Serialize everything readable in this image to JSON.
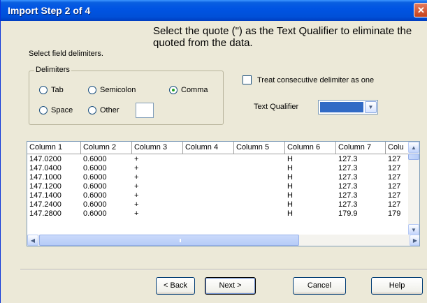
{
  "window": {
    "title": "Import Step 2 of 4",
    "close": "✕"
  },
  "instruction": "Select the quote (\") as the Text Qualifier to eliminate the quoted from the data.",
  "select_label": "Select field delimiters.",
  "delimiters": {
    "title": "Delimiters",
    "options": [
      {
        "label": "Tab",
        "checked": false
      },
      {
        "label": "Semicolon",
        "checked": false
      },
      {
        "label": "Comma",
        "checked": true
      },
      {
        "label": "Space",
        "checked": false
      },
      {
        "label": "Other",
        "checked": false
      }
    ],
    "other_value": ""
  },
  "consecutive": {
    "label": "Treat consecutive delimiter as one",
    "checked": false
  },
  "text_qualifier": {
    "label": "Text Qualifier",
    "value": "\"",
    "arrow": "▼"
  },
  "table": {
    "headers": [
      "Column 1",
      "Column 2",
      "Column 3",
      "Column 4",
      "Column 5",
      "Column 6",
      "Column 7",
      "Colu"
    ],
    "rows": [
      [
        "147.0200",
        "0.6000",
        "+",
        "",
        "",
        "H",
        "127.3",
        "127"
      ],
      [
        "147.0400",
        "0.6000",
        "+",
        "",
        "",
        "H",
        "127.3",
        "127"
      ],
      [
        "147.1000",
        "0.6000",
        "+",
        "",
        "",
        "H",
        "127.3",
        "127"
      ],
      [
        "147.1200",
        "0.6000",
        "+",
        "",
        "",
        "H",
        "127.3",
        "127"
      ],
      [
        "147.1400",
        "0.6000",
        "+",
        "",
        "",
        "H",
        "127.3",
        "127"
      ],
      [
        "147.2400",
        "0.6000",
        "+",
        "",
        "",
        "H",
        "127.3",
        "127"
      ],
      [
        "147.2800",
        "0.6000",
        "+",
        "",
        "",
        "H",
        "179.9",
        "179"
      ]
    ],
    "scroll_up": "▲",
    "scroll_down": "▼",
    "scroll_left": "◀",
    "scroll_right": "▶"
  },
  "buttons": {
    "back": "< Back",
    "next": "Next >",
    "cancel": "Cancel",
    "help": "Help"
  },
  "colors": {
    "title_bar": "#0054E3",
    "dialog_bg": "#ECE9D8",
    "selection": "#316AC5"
  }
}
